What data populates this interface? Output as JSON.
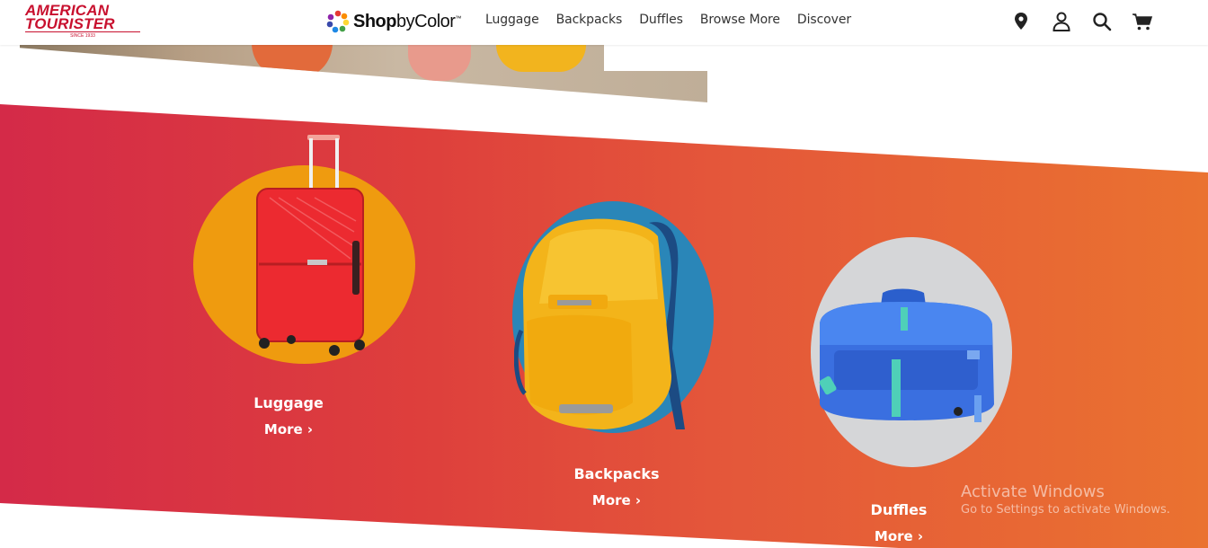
{
  "brand": {
    "logo_line1": "AMERICAN",
    "logo_line2": "TOURISTER",
    "logo_since": "SINCE 1933",
    "color": "#c8102e"
  },
  "shop_by_color": {
    "bold": "Shop",
    "regular": "byColor",
    "tm": "™"
  },
  "nav": {
    "items": [
      "Luggage",
      "Backpacks",
      "Duffles",
      "Browse More",
      "Discover"
    ]
  },
  "header_icons": [
    "location-pin-icon",
    "user-icon",
    "search-icon",
    "cart-icon"
  ],
  "categories": [
    {
      "name": "Luggage",
      "more": "More ›",
      "circle_color": "#ef9b0f"
    },
    {
      "name": "Backpacks",
      "more": "More ›",
      "circle_color": "#2a86b8"
    },
    {
      "name": "Duffles",
      "more": "More ›",
      "circle_color": "#d5d6d8"
    }
  ],
  "band_gradient": [
    "#d42a48",
    "#ea7230"
  ],
  "watermark": {
    "line1": "Activate Windows",
    "line2": "Go to Settings to activate Windows."
  }
}
